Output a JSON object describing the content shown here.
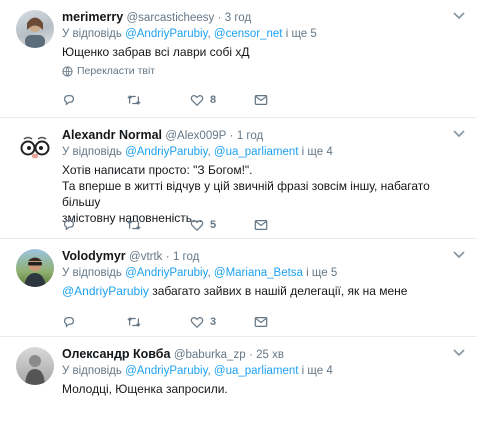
{
  "colors": {
    "link": "#1da1f2",
    "muted": "#657786",
    "text": "#14171a",
    "divider": "#e6ecf0"
  },
  "tweets": [
    {
      "name": "merimerry",
      "handle": "@sarcasticheesy",
      "sep": "·",
      "time": "3 год",
      "reply_prefix": "У відповідь",
      "reply_mention_1": "@AndriyParubiy",
      "reply_comma": ",",
      "reply_mention_2": "@censor_net",
      "reply_suffix": "і ще 5",
      "text": "Ющенко забрав всі лаври собі хД",
      "translate_label": "Перекласти твіт",
      "reply_count": "",
      "retweet_count": "",
      "like_count": "8"
    },
    {
      "name": "Alexandr Normal",
      "handle": "@Alex009P",
      "sep": "·",
      "time": "1 год",
      "reply_prefix": "У відповідь",
      "reply_mention_1": "@AndriyParubiy",
      "reply_comma": ",",
      "reply_mention_2": "@ua_parliament",
      "reply_suffix": "і ще 4",
      "text_lines": [
        "Хотів написати просто: \"З Богом!\".",
        "Та вперше в житті відчув у цій звичній фразі зовсім іншу, набагато більшу",
        "змістовну наповненість..."
      ],
      "reply_count": "",
      "retweet_count": "",
      "like_count": "5"
    },
    {
      "name": "Volodymyr",
      "handle": "@vtrtk",
      "sep": "·",
      "time": "1 год",
      "reply_prefix": "У відповідь",
      "reply_mention_1": "@AndriyParubiy",
      "reply_comma": ",",
      "reply_mention_2": "@Mariana_Betsa",
      "reply_suffix": "і ще 5",
      "text_mention": "@AndriyParubiy",
      "text_rest": "забагато зайвих в нашій делегації, як на мене",
      "reply_count": "",
      "retweet_count": "",
      "like_count": "3"
    },
    {
      "name": "Олександр Ковба",
      "handle": "@baburka_zp",
      "sep": "·",
      "time": "25 хв",
      "reply_prefix": "У відповідь",
      "reply_mention_1": "@AndriyParubiy",
      "reply_comma": ",",
      "reply_mention_2": "@ua_parliament",
      "reply_suffix": "і ще 4",
      "text": "Молодці, Ющенка запросили."
    }
  ],
  "icons": [
    "reply-icon",
    "retweet-icon",
    "like-icon",
    "direct-message-icon",
    "more-caret-icon",
    "globe-icon"
  ]
}
